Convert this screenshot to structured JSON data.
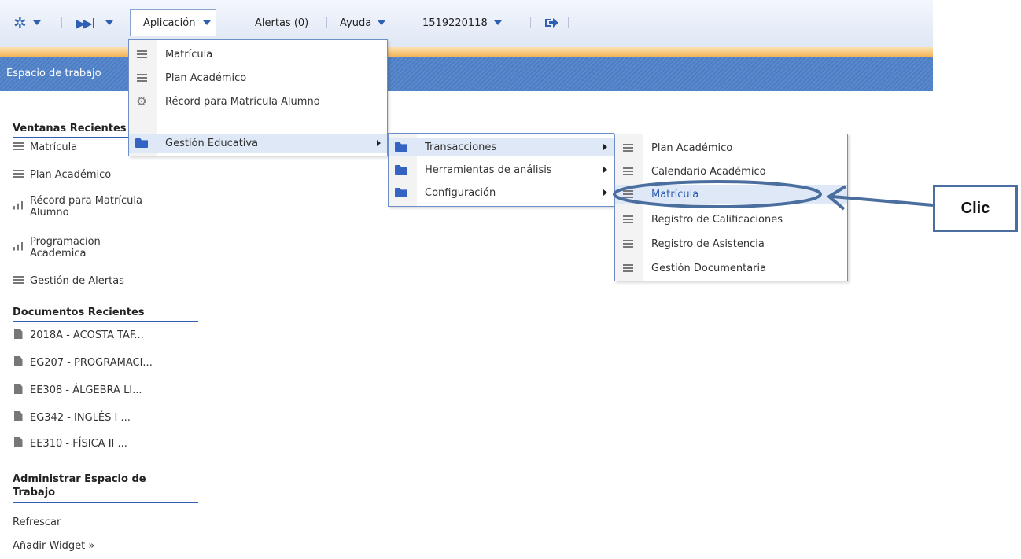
{
  "topnav": {
    "aplicacion": "Aplicación",
    "alertas": "Alertas (0)",
    "ayuda": "Ayuda",
    "usuario": "1519220118"
  },
  "workspace_title": "Espacio de trabajo",
  "sidebar": {
    "recent_windows_title": "Ventanas Recientes",
    "recent_windows": [
      {
        "label": "Matrícula",
        "icon": "list-icon"
      },
      {
        "label": "Plan Académico",
        "icon": "list-icon"
      },
      {
        "label": "Récord para Matrícula Alumno",
        "icon": "bar-chart-icon"
      },
      {
        "label": "Programacion Academica",
        "icon": "bar-chart-icon"
      },
      {
        "label": "Gestión de Alertas",
        "icon": "list-icon"
      }
    ],
    "recent_docs_title": "Documentos Recientes",
    "recent_docs": [
      "2018A - ACOSTA TAF...",
      "EG207 - PROGRAMACI...",
      "EE308 - ÁLGEBRA LI...",
      "EG342 - INGLÉS I ...",
      "EE310 - FÍSICA II ..."
    ],
    "manage_title": "Administrar Espacio de Trabajo",
    "manage_items": [
      "Refrescar",
      "Añadir Widget »"
    ]
  },
  "menu_aplicacion": [
    {
      "label": "Matrícula",
      "icon": "list-icon"
    },
    {
      "label": "Plan Académico",
      "icon": "list-icon"
    },
    {
      "label": "Récord para Matrícula Alumno",
      "icon": "gear-icon"
    },
    {
      "label": "Gestión Educativa",
      "icon": "folder-icon",
      "submenu": true
    }
  ],
  "menu_gestion": [
    {
      "label": "Transacciones",
      "icon": "folder-icon"
    },
    {
      "label": "Herramientas de análisis",
      "icon": "folder-icon"
    },
    {
      "label": "Configuración",
      "icon": "folder-icon"
    }
  ],
  "menu_transacciones": [
    {
      "label": "Plan Académico",
      "icon": "list-icon"
    },
    {
      "label": "Calendario Académico",
      "icon": "list-icon"
    },
    {
      "label": "Matrícula",
      "icon": "list-icon"
    },
    {
      "label": "Registro de Calificaciones",
      "icon": "list-icon"
    },
    {
      "label": "Registro de Asistencia",
      "icon": "list-icon"
    },
    {
      "label": "Gestión Documentaria",
      "icon": "list-icon"
    }
  ],
  "callout": "Clic",
  "colors": {
    "accent": "#2f5fb3",
    "annotation": "#4a6f9e",
    "header_band": "#4d7ec4"
  }
}
